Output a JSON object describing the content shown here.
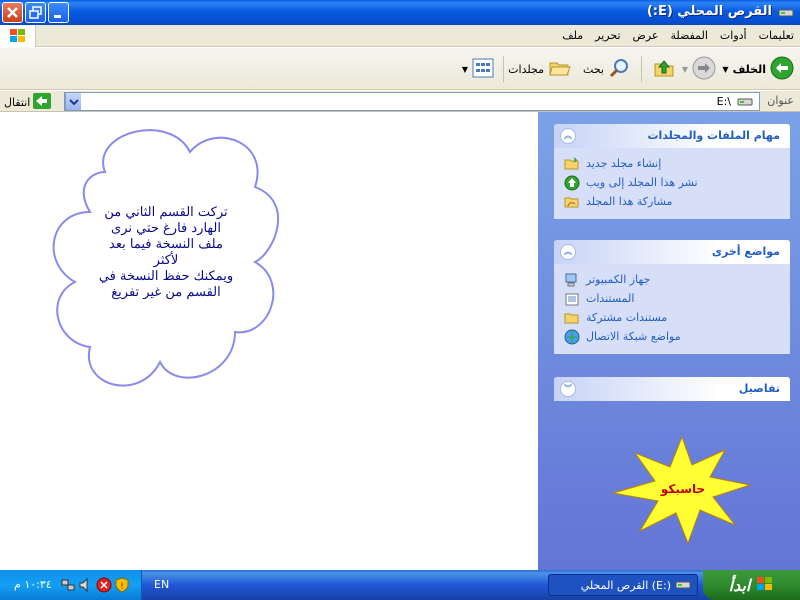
{
  "window": {
    "title": "القرص المحلي (E:)",
    "title_icon": "drive-icon",
    "buttons": [
      "close",
      "maximize",
      "minimize"
    ]
  },
  "menu": {
    "items": [
      "ملف",
      "تحرير",
      "عرض",
      "المفضلة",
      "أدوات",
      "تعليمات"
    ]
  },
  "toolbar": {
    "back": "الخلف",
    "search": "بحث",
    "folders": "مجلدات"
  },
  "address": {
    "label": "عنوان",
    "value": "E:\\",
    "go": "انتقال"
  },
  "tasks": {
    "file_tasks": {
      "title": "مهام الملفات والمجلدات",
      "items": [
        "إنشاء مجلد جديد",
        "نشر هذا المجلد إلى ويب",
        "مشاركة هذا المجلد"
      ]
    },
    "other_places": {
      "title": "مواضع أخرى",
      "items": [
        "جهاز الكمبيوتر",
        "المستندات",
        "مستندات مشتركة",
        "مواضع شبكة الاتصال"
      ]
    },
    "details": {
      "title": "تفاصيل"
    }
  },
  "annotation": {
    "cloud_lines": [
      "تركت القسم الثاني من",
      "الهارد فارغ حتي نرى",
      "ملف النسخة فيما بعد",
      "لأكثر",
      "ويمكنك حفظ النسخة في",
      "القسم من غير تفريغ"
    ],
    "starburst": "حاسبكو"
  },
  "taskbar": {
    "start": "ابدأ",
    "task": "القرص المحلي (E:)",
    "lang": "EN",
    "clock": "١٠:٣٤ م"
  },
  "colors": {
    "title_blue": "#0a5fe0",
    "task_pane": "#7ba2e7",
    "link_blue": "#215dc6",
    "start_green": "#2e8b2e",
    "star_yellow": "#ffff33"
  }
}
